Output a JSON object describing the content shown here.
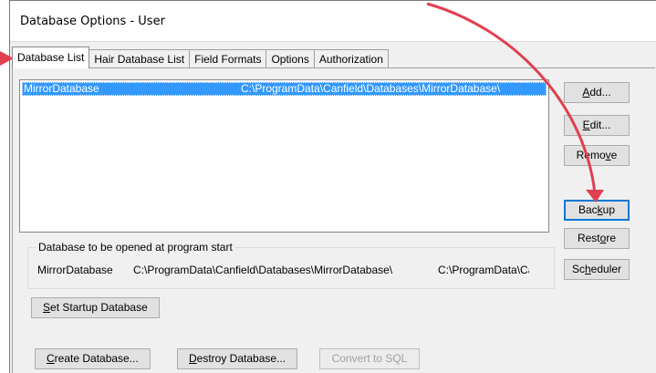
{
  "window": {
    "title": "Database Options - User"
  },
  "tabs": [
    {
      "label": "Database List"
    },
    {
      "label": "Hair Database List"
    },
    {
      "label": "Field Formats"
    },
    {
      "label": "Options"
    },
    {
      "label": "Authorization"
    }
  ],
  "database_list": {
    "rows": [
      {
        "name": "MirrorDatabase",
        "path": "C:\\ProgramData\\Canfield\\Databases\\MirrorDatabase\\"
      }
    ]
  },
  "side_buttons": {
    "add": {
      "pre": "",
      "key": "A",
      "post": "dd..."
    },
    "edit": {
      "pre": "",
      "key": "E",
      "post": "dit..."
    },
    "remove": {
      "pre": "Remo",
      "key": "v",
      "post": "e"
    },
    "backup": {
      "pre": "Bac",
      "key": "k",
      "post": "up"
    },
    "restore": {
      "pre": "Rest",
      "key": "o",
      "post": "re"
    },
    "scheduler": {
      "pre": "Sc",
      "key": "h",
      "post": "eduler"
    }
  },
  "startup_group": {
    "label": "Database to be opened at program start",
    "name": "MirrorDatabase",
    "path": "C:\\ProgramData\\Canfield\\Databases\\MirrorDatabase\\",
    "path2": "C:\\ProgramData\\Canfie"
  },
  "bottom_buttons": {
    "set_startup": {
      "pre": "",
      "key": "S",
      "post": "et Startup Database"
    },
    "create": {
      "pre": "",
      "key": "C",
      "post": "reate Database..."
    },
    "destroy": {
      "pre": "",
      "key": "D",
      "post": "estroy Database..."
    },
    "convert": "Convert to SQL"
  },
  "colors": {
    "selection": "#3399ff",
    "annotation_arrow": "#e04050"
  }
}
